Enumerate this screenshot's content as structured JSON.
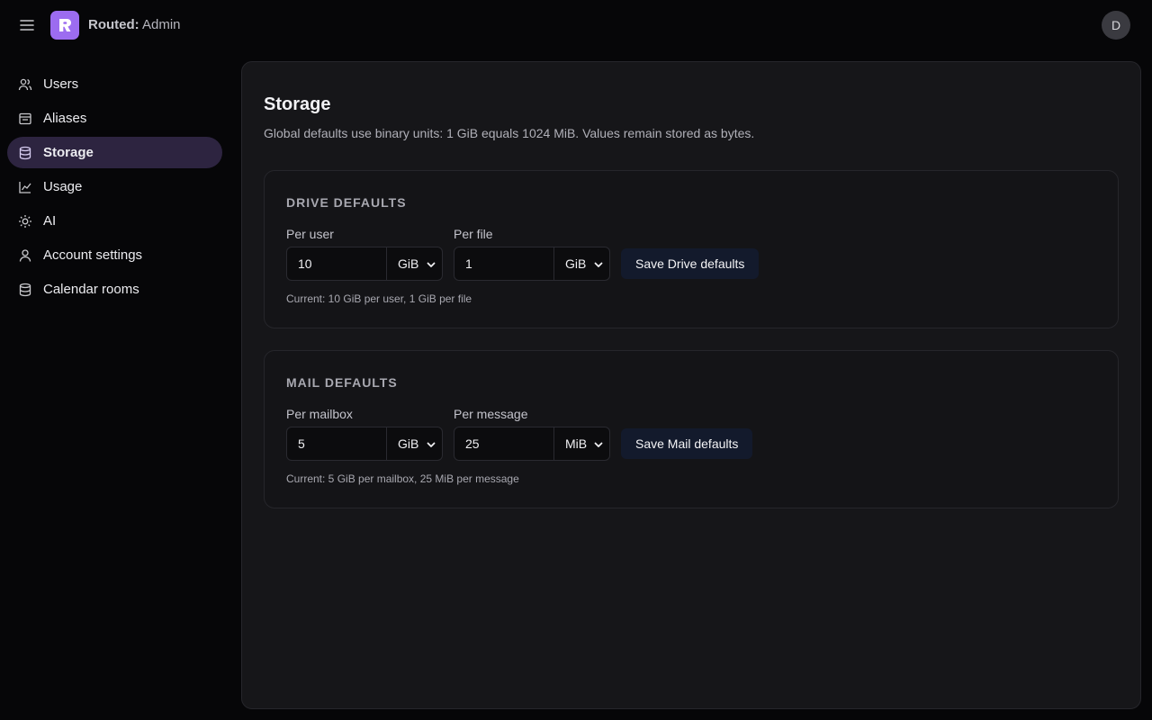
{
  "header": {
    "app_name": "Routed:",
    "app_suffix": " Admin",
    "logo_letter": "r",
    "avatar_initial": "D",
    "icons": {
      "menu": "hamburger-icon",
      "logo": "routed-logo"
    }
  },
  "sidebar": {
    "items": [
      {
        "label": "Users",
        "icon": "users-icon",
        "active": false
      },
      {
        "label": "Aliases",
        "icon": "aliases-icon",
        "active": false
      },
      {
        "label": "Storage",
        "icon": "database-icon",
        "active": true
      },
      {
        "label": "Usage",
        "icon": "chart-line-icon",
        "active": false
      },
      {
        "label": "AI",
        "icon": "sun-icon",
        "active": false
      },
      {
        "label": "Account settings",
        "icon": "user-icon",
        "active": false
      },
      {
        "label": "Calendar rooms",
        "icon": "database-icon",
        "active": false
      }
    ]
  },
  "main": {
    "title": "Storage",
    "description": "Global defaults use binary units: 1 GiB equals 1024 MiB. Values remain stored as bytes.",
    "drive": {
      "title": "DRIVE DEFAULTS",
      "per_user_label": "Per user",
      "per_user_value": "10",
      "per_user_unit": "GiB",
      "per_file_label": "Per file",
      "per_file_value": "1",
      "per_file_unit": "GiB",
      "save_label": "Save Drive defaults",
      "current": "Current: 10 GiB per user, 1 GiB per file"
    },
    "mail": {
      "title": "MAIL DEFAULTS",
      "per_mailbox_label": "Per mailbox",
      "per_mailbox_value": "5",
      "per_mailbox_unit": "GiB",
      "per_message_label": "Per message",
      "per_message_value": "25",
      "per_message_unit": "MiB",
      "save_label": "Save Mail defaults",
      "current": "Current: 5 GiB per mailbox, 25 MiB per message"
    }
  },
  "colors": {
    "accent": "#9c6cf0",
    "active_nav_bg": "#2d2440",
    "panel_bg": "#161619",
    "button_bg": "#131a2c"
  }
}
